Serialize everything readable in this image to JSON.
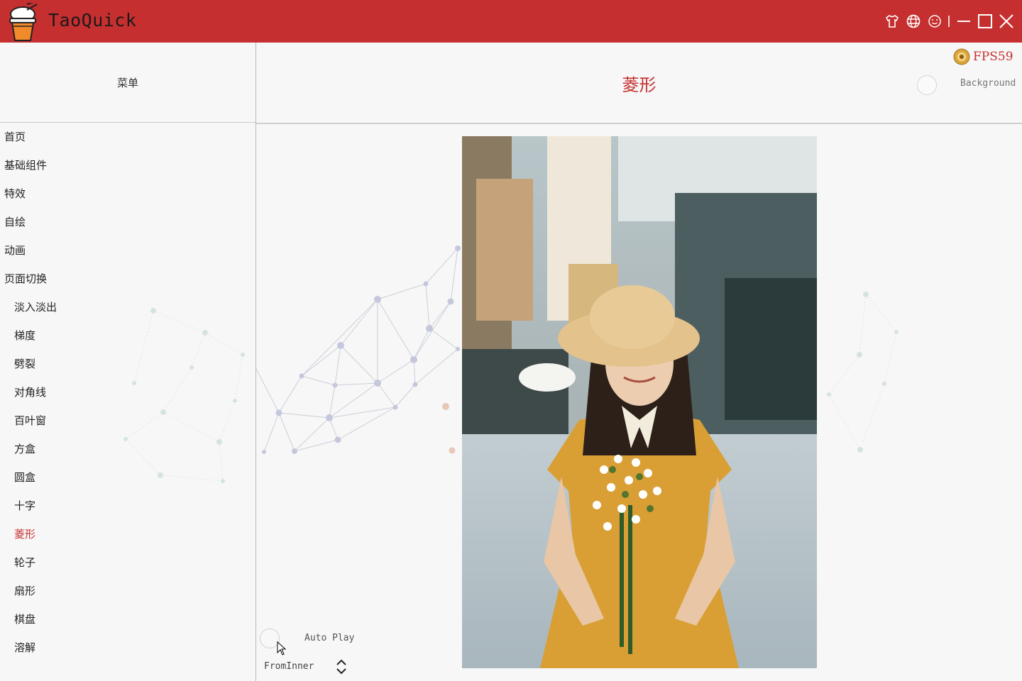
{
  "app": {
    "title": "TaoQuick"
  },
  "titlebar": {
    "buttons": [
      {
        "name": "skin",
        "icon": "tshirt-icon"
      },
      {
        "name": "language",
        "icon": "globe-icon"
      },
      {
        "name": "about",
        "icon": "smiley-icon"
      },
      {
        "name": "minimize",
        "icon": "minimize-icon"
      },
      {
        "name": "maximize",
        "icon": "maximize-icon"
      },
      {
        "name": "close",
        "icon": "close-icon"
      }
    ]
  },
  "sidebar": {
    "title": "菜单",
    "items": [
      {
        "label": "首页"
      },
      {
        "label": "基础组件"
      },
      {
        "label": "特效"
      },
      {
        "label": "自绘"
      },
      {
        "label": "动画"
      },
      {
        "label": "页面切换"
      },
      {
        "label": "淡入淡出"
      },
      {
        "label": "梯度"
      },
      {
        "label": "劈裂"
      },
      {
        "label": "对角线"
      },
      {
        "label": "百叶窗"
      },
      {
        "label": "方盒"
      },
      {
        "label": "圆盒"
      },
      {
        "label": "十字"
      },
      {
        "label": "菱形",
        "active": true
      },
      {
        "label": "轮子"
      },
      {
        "label": "扇形"
      },
      {
        "label": "棋盘"
      },
      {
        "label": "溶解"
      }
    ]
  },
  "header": {
    "title": "菱形",
    "fps_label": "FPS59",
    "background_label": "Background",
    "background_checked": false
  },
  "controls": {
    "auto_play_label": "Auto Play",
    "auto_play_checked": false,
    "direction_value": "FromInner"
  },
  "colors": {
    "accent": "#c62f2f",
    "titlebar": "#c62f2f",
    "background": "#f7f7f7"
  }
}
